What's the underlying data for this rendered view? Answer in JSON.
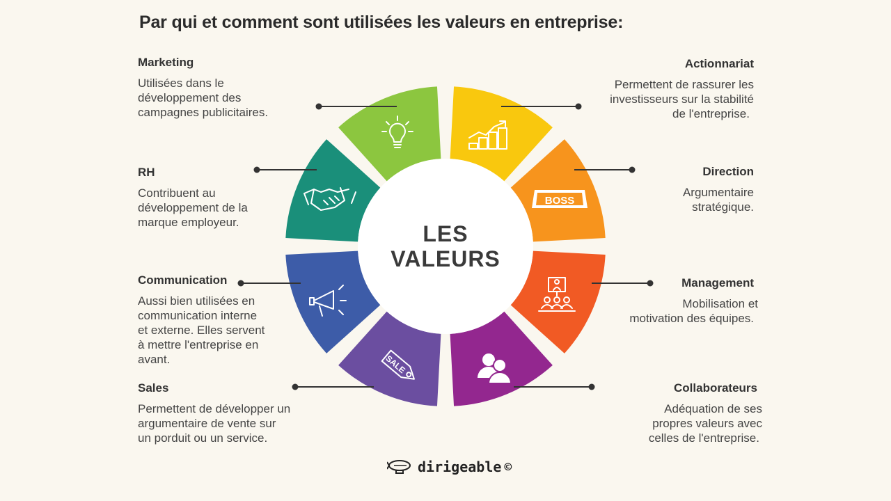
{
  "title": "Par qui et comment sont utilisées les valeurs en entreprise:",
  "center": {
    "line1": "LES",
    "line2": "VALEURS"
  },
  "brand": {
    "name": "dirigeable",
    "symbol": "©"
  },
  "colors": {
    "marketing": "#8cc63f",
    "actionnariat": "#f9c80e",
    "direction": "#f7941d",
    "management": "#f15a24",
    "collaborateurs": "#93278f",
    "sales": "#6b4ea0",
    "communication": "#3d5ca8",
    "rh": "#1a8f7a"
  },
  "sections": {
    "marketing": {
      "title": "Marketing",
      "lines": [
        "Utilisées dans le",
        "développement des",
        "campagnes publicitaires."
      ],
      "icon": "lightbulb-icon"
    },
    "rh": {
      "title": "RH",
      "lines": [
        "Contribuent au",
        "développement de la",
        "marque employeur."
      ],
      "icon": "handshake-icon"
    },
    "communication": {
      "title": "Communication",
      "lines": [
        "Aussi bien utilisées en",
        "communication interne",
        "et externe. Elles servent",
        "à mettre l'entreprise en",
        "avant."
      ],
      "icon": "megaphone-icon"
    },
    "sales": {
      "title": "Sales",
      "lines": [
        "Permettent de développer un",
        "argumentaire de vente sur",
        "un porduit ou un service."
      ],
      "icon": "sale-tag-icon",
      "tag_text": "SALE"
    },
    "actionnariat": {
      "title": "Actionnariat",
      "lines": [
        "Permettent de rassurer les",
        "investisseurs  sur la stabilité",
        "de l'entreprise."
      ],
      "icon": "growth-coins-icon"
    },
    "direction": {
      "title": "Direction",
      "lines": [
        "Argumentaire",
        "stratégique."
      ],
      "icon": "boss-sign-icon",
      "sign_text": "BOSS"
    },
    "management": {
      "title": "Management",
      "lines": [
        "Mobilisation et",
        "motivation des équipes."
      ],
      "icon": "presentation-icon"
    },
    "collaborateurs": {
      "title": "Collaborateurs",
      "lines": [
        "Adéquation de ses",
        "propres valeurs avec",
        "celles de l'entreprise."
      ],
      "icon": "users-icon"
    }
  }
}
